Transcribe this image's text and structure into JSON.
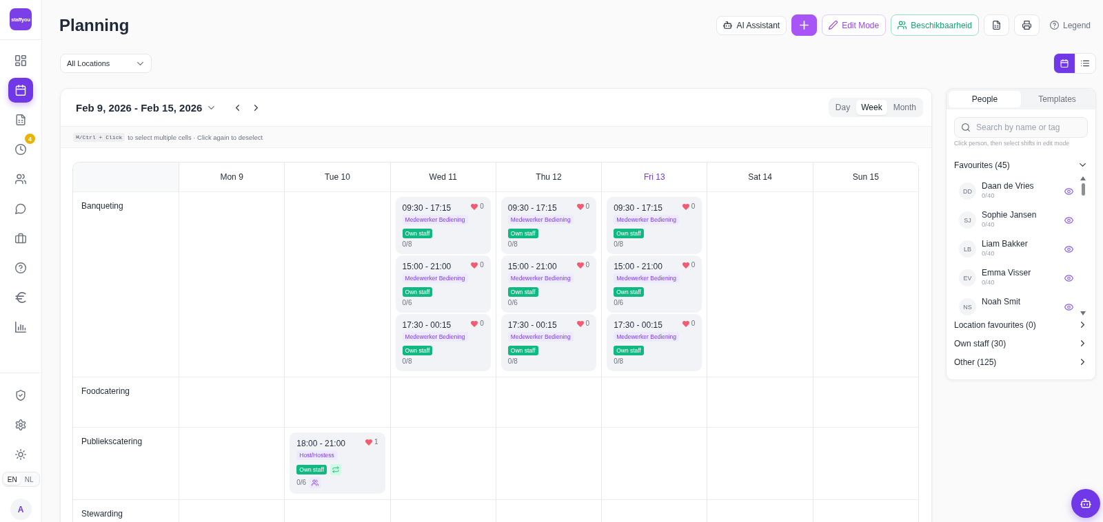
{
  "sidebar": {
    "logo": "staffyou",
    "nav": [
      {
        "selected": false
      },
      {
        "selected": true
      },
      {
        "selected": false
      },
      {
        "selected": false,
        "badge": "4"
      },
      {
        "selected": false
      },
      {
        "selected": false
      },
      {
        "selected": false
      },
      {
        "selected": false
      },
      {
        "selected": false
      },
      {
        "selected": false
      }
    ],
    "languages": [
      {
        "label": "EN",
        "selected": true
      },
      {
        "label": "NL",
        "selected": false
      }
    ],
    "avatar": "A"
  },
  "header": {
    "title": "Planning",
    "actions": [
      {
        "kind": "assistant",
        "label": "AI Assistant"
      },
      {
        "kind": "add"
      },
      {
        "kind": "edit",
        "label": "Edit Mode"
      },
      {
        "kind": "availability",
        "label": "Beschikbaarheid"
      },
      {
        "kind": "export"
      },
      {
        "kind": "print"
      },
      {
        "kind": "legend",
        "label": "Legend"
      }
    ]
  },
  "filters": {
    "location": "All Locations",
    "views": [
      {
        "selected": true
      },
      {
        "selected": false
      }
    ]
  },
  "calendar": {
    "range": "Feb 9, 2026 - Feb 15, 2026",
    "views": [
      {
        "label": "Day",
        "selected": false
      },
      {
        "label": "Week",
        "selected": true
      },
      {
        "label": "Month",
        "selected": false
      }
    ],
    "shortcut": "⌘/Ctrl + Click",
    "hint": "to select multiple cells · Click again to deselect",
    "days": [
      {
        "label": "Mon 9",
        "today": false
      },
      {
        "label": "Tue 10",
        "today": false
      },
      {
        "label": "Wed 11",
        "today": false
      },
      {
        "label": "Thu 12",
        "today": false
      },
      {
        "label": "Fri 13",
        "today": true
      },
      {
        "label": "Sat 14",
        "today": false
      },
      {
        "label": "Sun 15",
        "today": false
      }
    ],
    "rows": [
      {
        "label": "Banqueting",
        "cells": [
          null,
          null,
          {
            "shifts": [
              {
                "time": "09:30 - 17:15",
                "likes": "0",
                "role": "Medewerker Bediening",
                "contract": "Own staff",
                "contract_icon": false,
                "filled": "0/8",
                "filled_icon": false
              },
              {
                "time": "15:00 - 21:00",
                "likes": "0",
                "role": "Medewerker Bediening",
                "contract": "Own staff",
                "contract_icon": false,
                "filled": "0/6",
                "filled_icon": false
              },
              {
                "time": "17:30 - 00:15",
                "likes": "0",
                "role": "Medewerker Bediening",
                "contract": "Own staff",
                "contract_icon": false,
                "filled": "0/8",
                "filled_icon": false
              }
            ]
          },
          {
            "shifts": [
              {
                "time": "09:30 - 17:15",
                "likes": "0",
                "role": "Medewerker Bediening",
                "contract": "Own staff",
                "contract_icon": false,
                "filled": "0/8",
                "filled_icon": false
              },
              {
                "time": "15:00 - 21:00",
                "likes": "0",
                "role": "Medewerker Bediening",
                "contract": "Own staff",
                "contract_icon": false,
                "filled": "0/6",
                "filled_icon": false
              },
              {
                "time": "17:30 - 00:15",
                "likes": "0",
                "role": "Medewerker Bediening",
                "contract": "Own staff",
                "contract_icon": false,
                "filled": "0/8",
                "filled_icon": false
              }
            ]
          },
          {
            "shifts": [
              {
                "time": "09:30 - 17:15",
                "likes": "0",
                "role": "Medewerker Bediening",
                "contract": "Own staff",
                "contract_icon": false,
                "filled": "0/8",
                "filled_icon": false
              },
              {
                "time": "15:00 - 21:00",
                "likes": "0",
                "role": "Medewerker Bediening",
                "contract": "Own staff",
                "contract_icon": false,
                "filled": "0/6",
                "filled_icon": false
              },
              {
                "time": "17:30 - 00:15",
                "likes": "0",
                "role": "Medewerker Bediening",
                "contract": "Own staff",
                "contract_icon": false,
                "filled": "0/8",
                "filled_icon": false
              }
            ]
          },
          null,
          null
        ]
      },
      {
        "label": "Foodcatering"
      },
      {
        "label": "Publiekscatering",
        "cells": [
          null,
          {
            "shifts": [
              {
                "time": "18:00 - 21:00",
                "likes": "1",
                "role": "Host/Hostess",
                "contract": "Own staff",
                "contract_icon": true,
                "filled": "0/6",
                "filled_icon": true
              }
            ]
          },
          null,
          null,
          null,
          null,
          null
        ]
      },
      {
        "label": "Stewarding"
      }
    ]
  },
  "people_panel": {
    "tabs": [
      {
        "label": "People",
        "selected": true
      },
      {
        "label": "Templates",
        "selected": false
      }
    ],
    "search": {
      "placeholder": "Search by name or tag"
    },
    "hint": "Click person, then select shifts in edit mode",
    "groups": [
      {
        "label": "Favourites (45)",
        "expanded": true,
        "people": [
          {
            "initials": "DD",
            "name": "Daan de Vries",
            "hours": "0/40"
          },
          {
            "initials": "SJ",
            "name": "Sophie Jansen",
            "hours": "0/40"
          },
          {
            "initials": "LB",
            "name": "Liam Bakker",
            "hours": "0/40"
          },
          {
            "initials": "EV",
            "name": "Emma Visser",
            "hours": "0/40"
          },
          {
            "initials": "NS",
            "name": "Noah Smit"
          }
        ]
      },
      {
        "label": "Location favourites (0)",
        "expanded": false
      },
      {
        "label": "Own staff (30)",
        "expanded": false
      },
      {
        "label": "Other (125)",
        "expanded": false
      }
    ]
  }
}
